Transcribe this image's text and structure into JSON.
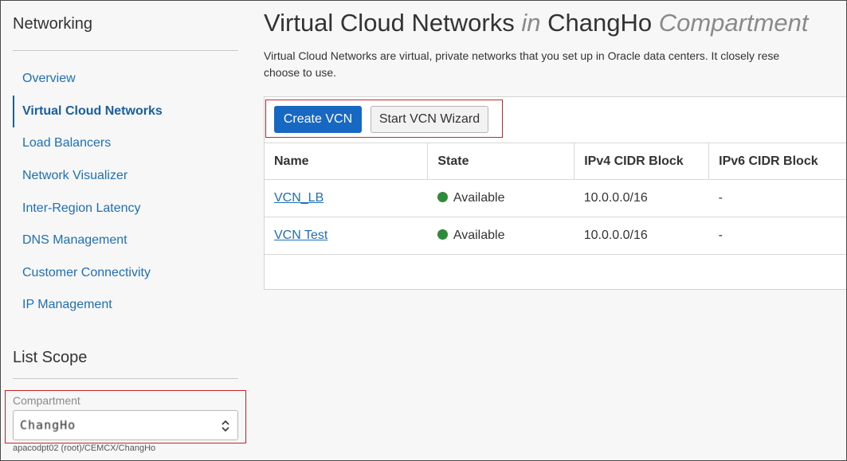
{
  "sidebar": {
    "heading": "Networking",
    "items": [
      {
        "label": "Overview",
        "active": false
      },
      {
        "label": "Virtual Cloud Networks",
        "active": true
      },
      {
        "label": "Load Balancers",
        "active": false
      },
      {
        "label": "Network Visualizer",
        "active": false
      },
      {
        "label": "Inter-Region Latency",
        "active": false
      },
      {
        "label": "DNS Management",
        "active": false
      },
      {
        "label": "Customer Connectivity",
        "active": false
      },
      {
        "label": "IP Management",
        "active": false
      }
    ],
    "scope_heading": "List Scope",
    "compartment": {
      "label": "Compartment",
      "value": "ChangHo",
      "path": "apacodpt02 (root)/CEMCX/ChangHo"
    }
  },
  "main": {
    "title": {
      "part1": "Virtual Cloud Networks",
      "part2": "in",
      "part3": "ChangHo",
      "part4": "Compartment"
    },
    "description": {
      "line1": "Virtual Cloud Networks are virtual, private networks that you set up in Oracle data centers. It closely rese",
      "line2": "choose to use."
    },
    "toolbar": {
      "create_label": "Create VCN",
      "wizard_label": "Start VCN Wizard"
    },
    "table": {
      "headers": [
        "Name",
        "State",
        "IPv4 CIDR Block",
        "IPv6 CIDR Block"
      ],
      "rows": [
        {
          "name": "VCN_LB",
          "state": "Available",
          "ipv4": "10.0.0.0/16",
          "ipv6": "-"
        },
        {
          "name": "VCN Test",
          "state": "Available",
          "ipv4": "10.0.0.0/16",
          "ipv6": "-"
        }
      ]
    }
  },
  "colors": {
    "link": "#1e6fb8",
    "primary_button": "#1768c2",
    "available_status": "#2e8b3a",
    "highlight_box": "#c8242b"
  }
}
